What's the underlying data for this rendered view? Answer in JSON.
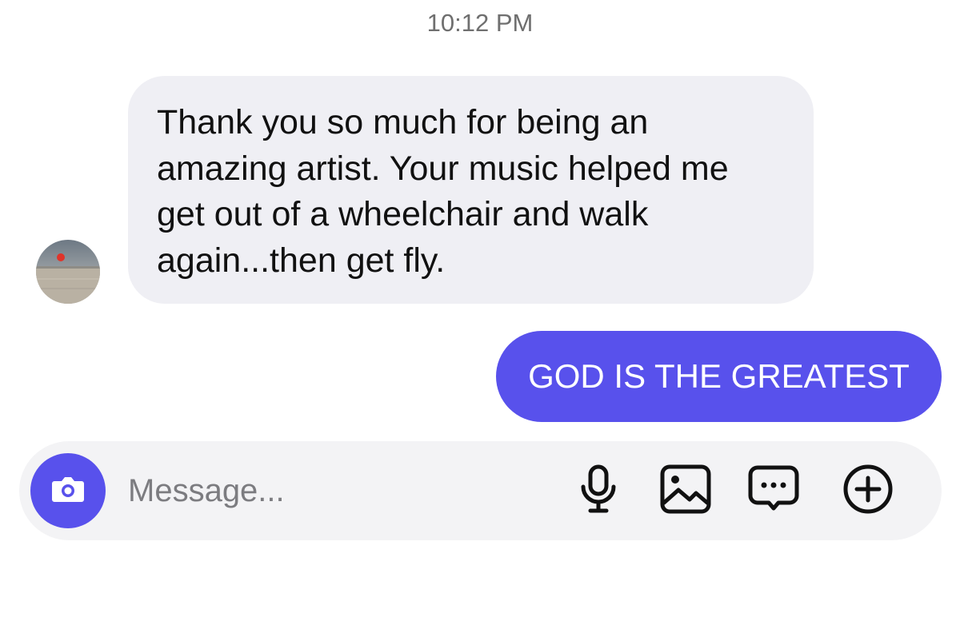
{
  "conversation": {
    "timestamp": "10:12 PM",
    "messages": [
      {
        "direction": "incoming",
        "text": "Thank you so much for being an\namazing artist. Your music helped me\nget out of a wheelchair and walk\nagain...then get fly."
      },
      {
        "direction": "outgoing",
        "text": "GOD IS THE GREATEST"
      }
    ]
  },
  "composer": {
    "placeholder": "Message...",
    "value": "",
    "icons": [
      "camera-icon",
      "microphone-icon",
      "image-icon",
      "sticker-icon",
      "plus-icon"
    ]
  },
  "colors": {
    "accent": "#5851ec",
    "incoming_bubble": "#efeff4",
    "composer_bg": "#f3f3f5",
    "timestamp": "#6f6f6f"
  }
}
